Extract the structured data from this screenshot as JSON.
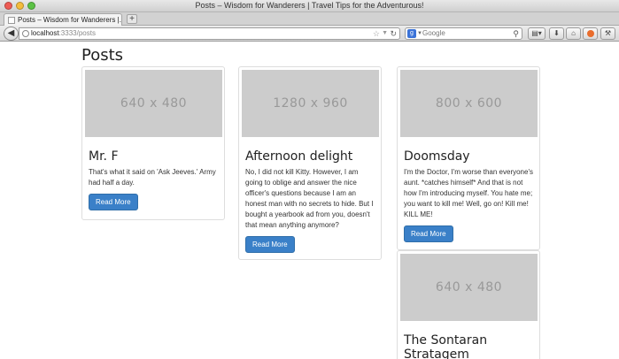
{
  "window": {
    "title": "Posts – Wisdom for Wanderers | Travel Tips for the Adventurous!"
  },
  "tabs": [
    {
      "label": "Posts – Wisdom for Wanderers |..."
    }
  ],
  "new_tab_label": "+",
  "address": {
    "host": "localhost",
    "path": ":3333/posts"
  },
  "search": {
    "placeholder": "Google"
  },
  "page": {
    "heading": "Posts",
    "posts": [
      {
        "image_label": "640 x 480",
        "title": "Mr. F",
        "body": "That's what it said on 'Ask Jeeves.' Army had half a day.",
        "button": "Read More"
      },
      {
        "image_label": "1280 x 960",
        "title": "Afternoon delight",
        "body": "No, I did not kill Kitty. However, I am going to oblige and answer the nice officer's questions because I am an honest man with no secrets to hide. But I bought a yearbook ad from you, doesn't that mean anything anymore?",
        "button": "Read More"
      },
      {
        "image_label": "800 x 600",
        "title": "Doomsday",
        "body": "I'm the Doctor, I'm worse than everyone's aunt. *catches himself* And that is not how I'm introducing myself. You hate me; you want to kill me! Well, go on! Kill me! KILL ME!",
        "button": "Read More"
      },
      {
        "image_label": "640 x 480",
        "title": "The Sontaran Stratagem",
        "body": "",
        "button": ""
      }
    ]
  },
  "colors": {
    "button": "#3a80c8",
    "placeholder_bg": "#cccccc"
  },
  "icons": [
    "close-icon",
    "minimize-icon",
    "zoom-icon",
    "back-icon",
    "globe-icon",
    "bookmark-star-icon",
    "reload-icon",
    "google-icon",
    "search-icon",
    "bookmarks-icon",
    "download-icon",
    "home-icon",
    "addon-icon",
    "tools-icon"
  ]
}
